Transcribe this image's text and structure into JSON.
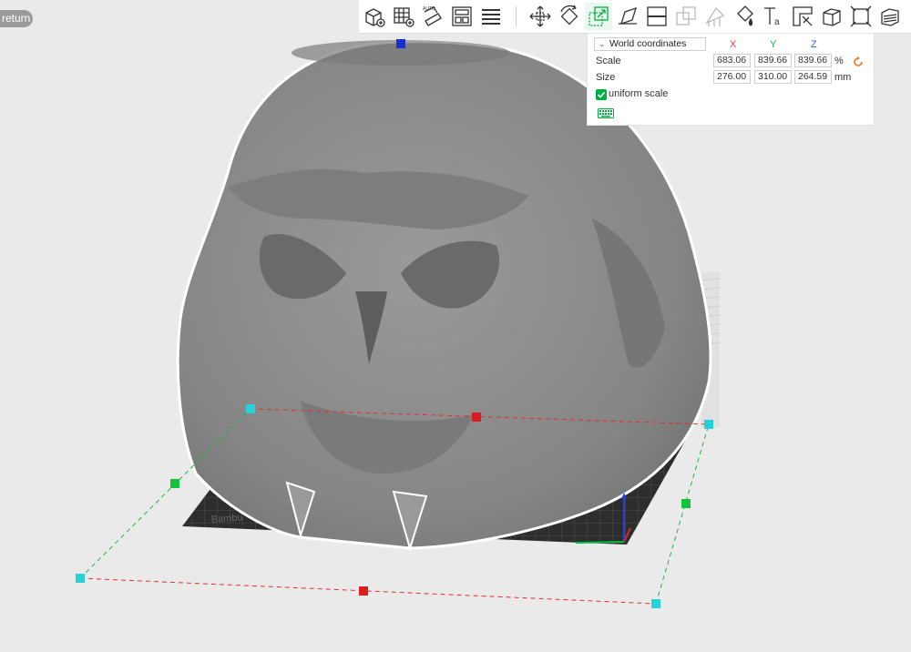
{
  "return_label": "return",
  "toolbar": {
    "tools": [
      "add-cube-icon",
      "add-plate-icon",
      "auto-orient-icon",
      "arrange-icon",
      "layers-icon",
      "move-icon",
      "rotate-icon",
      "scale-icon",
      "lay-on-face-icon",
      "cut-icon",
      "boolean-icon",
      "support-paint-icon",
      "color-paint-icon",
      "text-icon",
      "measure-icon",
      "variable-layer-icon",
      "fuzzy-skin-icon",
      "slice-layers-icon"
    ]
  },
  "panel": {
    "coordinate_system": "World coordinates",
    "axes": [
      "X",
      "Y",
      "Z"
    ],
    "axis_colors": [
      "#e23c3c",
      "#22a84b",
      "#3b5bd9"
    ],
    "scale_label": "Scale",
    "scale_values": [
      "683.06",
      "839.66",
      "839.66"
    ],
    "scale_unit": "%",
    "size_label": "Size",
    "size_values": [
      "276.00",
      "310.00",
      "264.59"
    ],
    "size_unit": "mm",
    "uniform_label": "uniform scale",
    "uniform_checked": true
  },
  "colors": {
    "accent": "#00ae42",
    "model": "#8c8c8c",
    "bed": "#2b2b2b",
    "reset": "#f07a1e"
  }
}
